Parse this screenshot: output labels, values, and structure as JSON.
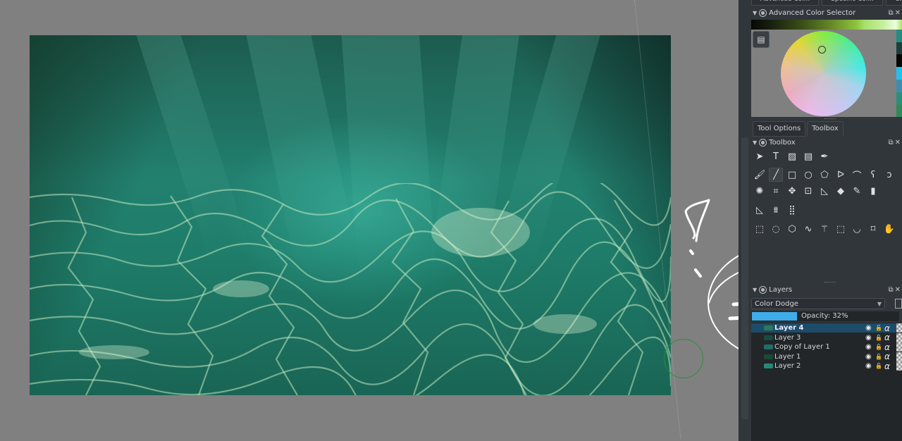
{
  "canvas": {
    "artwork_description": "underwater sea scene with light rays and caustics",
    "brush_cursor": "circle"
  },
  "dock": {
    "top_tabs": [
      "Advanced Col...",
      "Specific Col...",
      "C..."
    ],
    "color_selector": {
      "title": "Advanced Color Selector",
      "menu_icon": "menu-icon",
      "swatches": [
        "#1f8f82",
        "#17403c",
        "#050705",
        "#22c0f0",
        "#3a8fb0",
        "#28907a",
        "#2e8a5a"
      ]
    },
    "tabs": [
      {
        "label": "Tool Options",
        "active": false
      },
      {
        "label": "Toolbox",
        "active": true
      }
    ],
    "toolbox": {
      "title": "Toolbox",
      "rows": [
        [
          "select-shapes-icon",
          "text-icon",
          "pattern-icon",
          "gradient-edit-icon",
          "calligraphy-icon"
        ],
        [
          "freehand-brush-icon",
          "line-icon",
          "rectangle-icon",
          "ellipse-icon",
          "polygon-icon",
          "polyline-icon",
          "bezier-icon",
          "freehand-path-icon",
          "dynamic-brush-icon"
        ],
        [
          "multibrush-icon",
          "crop-icon",
          "move-icon",
          "transform-icon",
          "measure-icon",
          "fill-icon",
          "color-picker-icon",
          "gradient-icon"
        ],
        [
          "assistant-icon",
          "perspective-grid-icon",
          "grid-icon"
        ],
        [
          "rect-select-icon",
          "ellipse-select-icon",
          "polygon-select-icon",
          "freehand-select-icon",
          "magic-wand-icon",
          "similar-select-icon",
          "bezier-select-icon",
          "zoom-fit-icon",
          "pan-icon"
        ]
      ],
      "row_glyphs": [
        [
          "➤",
          "T",
          "▨",
          "▤",
          "✒"
        ],
        [
          "🖌",
          "╱",
          "□",
          "○",
          "⬠",
          "ᐅ",
          "⌒",
          "ʕ",
          "ↄ"
        ],
        [
          "✺",
          "⌗",
          "✥",
          "⊡",
          "◺",
          "◆",
          "✎",
          "▮"
        ],
        [
          "◺",
          "⩩",
          "⣿"
        ],
        [
          "⬚",
          "◌",
          "⬡",
          "∿",
          "⚚",
          "⬚",
          "◡",
          "⌑",
          "✋"
        ]
      ]
    },
    "layers": {
      "title": "Layers",
      "blend_mode": "Color Dodge",
      "opacity_label": "Opacity:  32%",
      "opacity_value": 0.32,
      "items": [
        {
          "name": "Layer 4",
          "selected": true,
          "thumb": "#2a7a5a"
        },
        {
          "name": "Layer 3",
          "selected": false,
          "thumb": "#1a4a40"
        },
        {
          "name": "Copy of Layer 1",
          "selected": false,
          "thumb": "#1f6f68"
        },
        {
          "name": "Layer 1",
          "selected": false,
          "thumb": "#184a38"
        },
        {
          "name": "Layer 2",
          "selected": false,
          "thumb": "#238a78"
        }
      ],
      "row_icons": [
        "visible-eye-icon",
        "lock-icon",
        "alpha-lock-icon"
      ],
      "row_glyphs": [
        "◉",
        "🔓",
        "α"
      ]
    }
  },
  "colors": {
    "accent": "#3daee9",
    "panel_bg": "#31363b",
    "selected_row": "#1d4c6a"
  }
}
